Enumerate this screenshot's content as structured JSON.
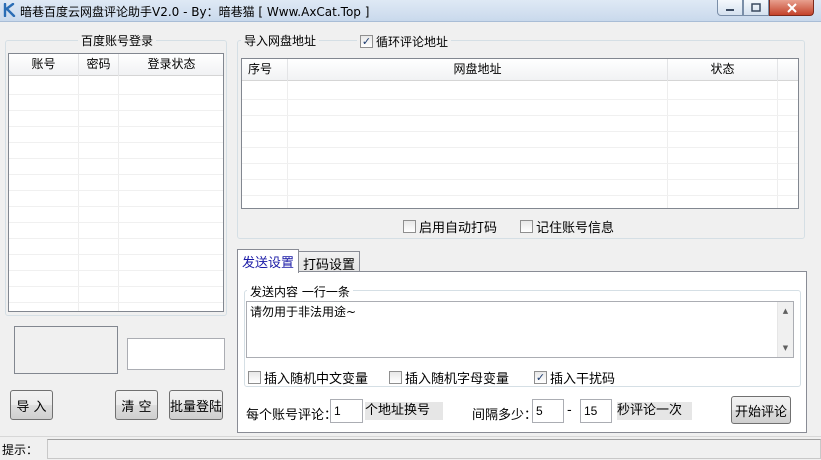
{
  "window": {
    "title": "暗巷百度云网盘评论助手V2.0 - By：暗巷猫  [ Www.AxCat.Top ]",
    "icon": "app-k-icon",
    "controls": {
      "minimize": "minimize-icon",
      "maximize": "maximize-icon",
      "close": "close-icon"
    }
  },
  "account_panel": {
    "title": "百度账号登录",
    "columns": [
      "账号",
      "密码",
      "登录状态"
    ],
    "rows": [],
    "import_label": "导 入",
    "clear_label": "清 空",
    "batch_login_label": "批量登陆",
    "captcha_input_value": ""
  },
  "import_panel": {
    "title": "导入网盘地址",
    "loop_checkbox": {
      "label": "循环评论地址",
      "checked": true
    },
    "columns": [
      "序号",
      "网盘地址",
      "状态"
    ],
    "rows": [],
    "auto_captcha": {
      "label": "启用自动打码",
      "checked": false
    },
    "remember_account": {
      "label": "记住账号信息",
      "checked": false
    }
  },
  "tabs": [
    {
      "label": "发送设置",
      "active": true
    },
    {
      "label": "打码设置",
      "active": false
    }
  ],
  "send_settings": {
    "content_group_title": "发送内容  一行一条",
    "content_text": "请勿用于非法用途~",
    "insert_cn_var": {
      "label": "插入随机中文变量",
      "checked": false
    },
    "insert_letter_var": {
      "label": "插入随机字母变量",
      "checked": false
    },
    "insert_noise": {
      "label": "插入干扰码",
      "checked": true
    },
    "per_account_label": "每个账号评论：",
    "per_account_value": "1",
    "per_account_suffix": "个地址换号",
    "interval_label": "间隔多少：",
    "interval_min": "5",
    "interval_sep": "-",
    "interval_max": "15",
    "interval_suffix": "秒评论一次",
    "start_label": "开始评论"
  },
  "status": {
    "label": "提示：",
    "message": ""
  },
  "colors": {
    "accent": "#1a1aa6",
    "check": "#1c3b6e"
  }
}
